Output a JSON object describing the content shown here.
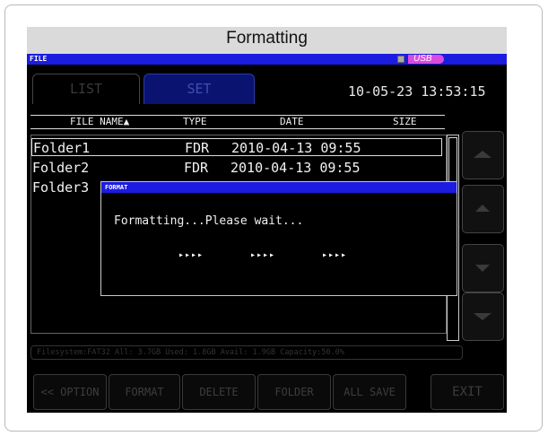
{
  "window_title": "Formatting",
  "screen": {
    "file_bar_label": "FILE",
    "usb_label": "USB",
    "tabs": [
      {
        "label": "LIST"
      },
      {
        "label": "SET"
      }
    ],
    "clock": "10-05-23 13:53:15",
    "columns": [
      "FILE NAME▲",
      "TYPE",
      "DATE",
      "SIZE"
    ],
    "rows": [
      {
        "name": "Folder1",
        "type": "FDR",
        "date": "2010-04-13 09:55",
        "selected": true
      },
      {
        "name": "Folder2",
        "type": "FDR",
        "date": "2010-04-13 09:55",
        "selected": false
      },
      {
        "name": "Folder3",
        "type": "",
        "date": "",
        "selected": false
      }
    ],
    "status_line": "Filesystem:FAT32 All: 3.7GB Used: 1.8GB Avail: 1.9GB Capacity:50.0%",
    "buttons": [
      {
        "label": "<< OPTION"
      },
      {
        "label": "FORMAT"
      },
      {
        "label": "DELETE"
      },
      {
        "label": "FOLDER"
      },
      {
        "label": "ALL SAVE"
      },
      {
        "label": "EXIT"
      }
    ]
  },
  "dialog": {
    "title": "FORMAT",
    "message": "Formatting...Please wait...",
    "progress": [
      "▸▸▸▸",
      "▸▸▸▸",
      "▸▸▸▸"
    ]
  },
  "colors": {
    "title_bar_bg": "#dadada",
    "screen_bg": "#000000",
    "header_blue": "#1c1ce0",
    "usb_badge": "#d94ce0",
    "set_tab": "#0a1470"
  }
}
